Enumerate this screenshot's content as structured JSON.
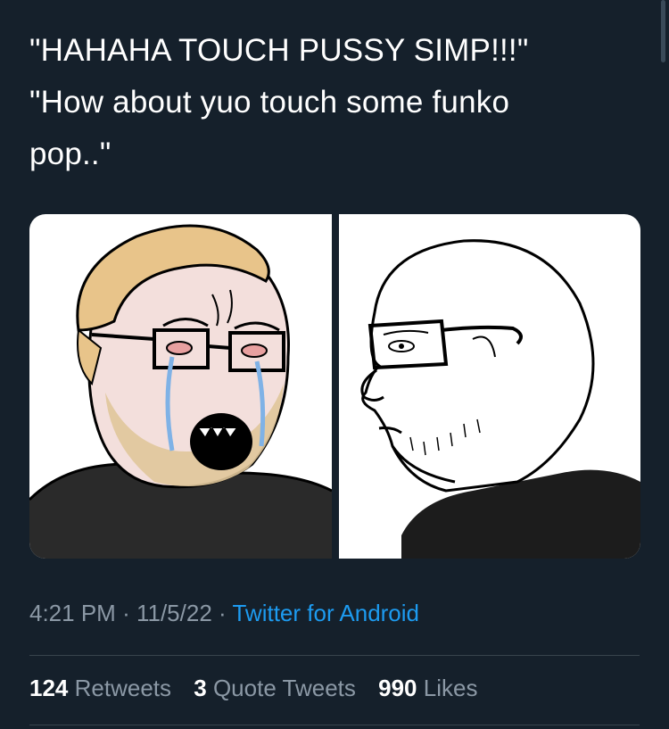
{
  "tweet": {
    "text_lines": [
      "\"HAHAHA TOUCH PUSSY SIMP!!!\"",
      "\"How about yuo touch some funko",
      "pop..\""
    ]
  },
  "meta": {
    "time": "4:21 PM",
    "separator": "·",
    "date": "11/5/22",
    "source": "Twitter for Android"
  },
  "stats": {
    "retweets_count": "124",
    "retweets_label": "Retweets",
    "quotes_count": "3",
    "quotes_label": "Quote Tweets",
    "likes_count": "990",
    "likes_label": "Likes"
  },
  "colors": {
    "background": "#15202b",
    "text": "#ffffff",
    "muted": "#8b98a5",
    "link": "#1d9bf0",
    "divider": "#38444d"
  },
  "media": {
    "left_image": "crying-wojak-illustration",
    "right_image": "calm-bald-wojak-illustration"
  }
}
